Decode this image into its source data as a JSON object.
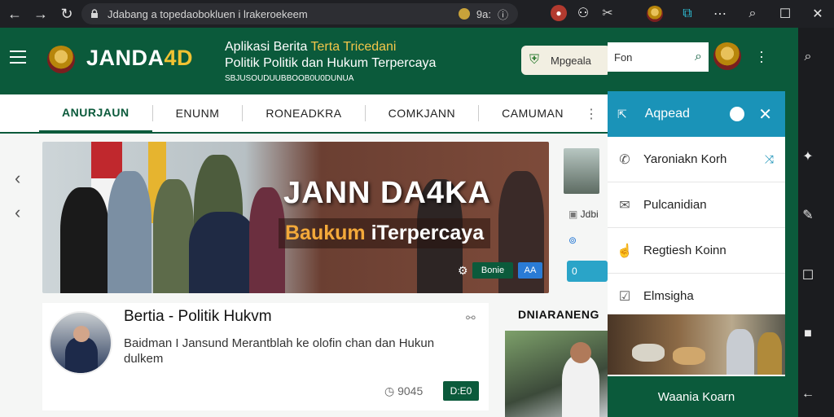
{
  "browser": {
    "url": "Jdabang a topedaobokluen i lrakeroekeem",
    "url_right": "9a:",
    "nav_back": "←",
    "nav_forward": "→",
    "nav_reload": "↻"
  },
  "site": {
    "logo": {
      "main": "JANDA",
      "accent": "4D"
    },
    "tagline": {
      "line1_pre": "Aplikasi Berita ",
      "line1_accent": "Terta Tricedani",
      "line2": "Politik Politik dan Hukum Terpercaya",
      "line3": "SBJUSOUDUUBBOOB0U0DUNUA"
    },
    "header_pill": "Mpgeala",
    "nav": [
      "ANURJAUN",
      "ENUNM",
      "RONEADKRA",
      "COMKJANN",
      "CAMUMAN"
    ],
    "hero": {
      "title": "JANN DA4KA",
      "sub_a": "Baukum",
      "sub_b": " iTerpercaya",
      "btn1": "Bonie",
      "btn2": "AA"
    },
    "side_mini": "Jdbi",
    "side_blue": "0",
    "article": {
      "title": "Bertia - Politik Hukvm",
      "desc": "Baidman I Jansund Merantblah ke olofin chan dan Hukun dulkem",
      "meta": "◷ 9045",
      "badge": "D:E0"
    },
    "pengumuman": "DNIARANENG"
  },
  "panel": {
    "search_text": "Fon",
    "header_label": "Aqpead",
    "items": [
      {
        "label": "Yaroniakn Korh",
        "icon": "phone-icon"
      },
      {
        "label": "Pulcanidian",
        "icon": "mail-icon"
      },
      {
        "label": "Regtiesh Koinn",
        "icon": "hand-icon"
      },
      {
        "label": "Elmsigha",
        "icon": "check-box-icon"
      }
    ],
    "footer": "Waania Koarn"
  },
  "colors": {
    "brand_green": "#0b5a3b",
    "accent_gold": "#f3c64a",
    "panel_blue": "#1a93b8"
  }
}
